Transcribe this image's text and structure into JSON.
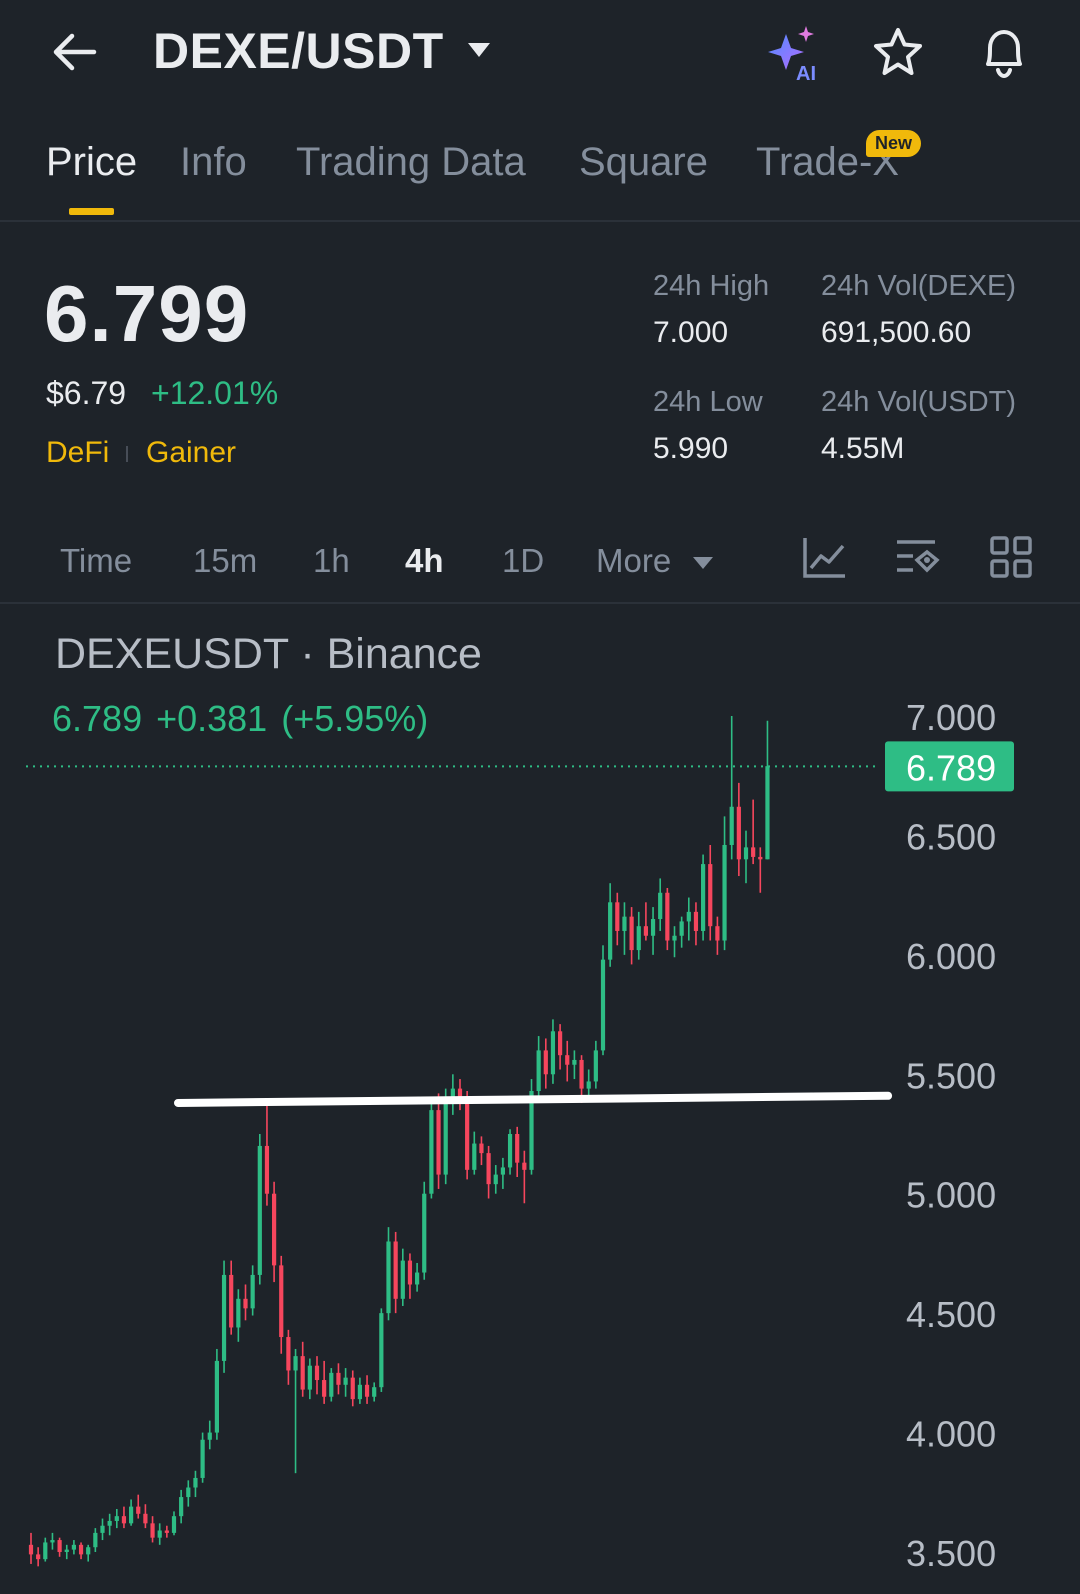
{
  "header": {
    "pair": "DEXE/USDT",
    "icons": [
      "back-arrow-icon",
      "chevron-down-icon",
      "ai-sparkle-icon",
      "star-icon",
      "bell-icon"
    ]
  },
  "tabs": [
    {
      "label": "Price",
      "active": true
    },
    {
      "label": "Info"
    },
    {
      "label": "Trading Data"
    },
    {
      "label": "Square"
    },
    {
      "label": "Trade-X",
      "badge": "New"
    }
  ],
  "ticker": {
    "last_price": "6.799",
    "usd_price": "$6.79",
    "change_pct": "+12.01%",
    "tags": [
      "DeFi",
      "Gainer"
    ],
    "stats": {
      "high_label": "24h High",
      "high_value": "7.000",
      "vol_base_label": "24h Vol(DEXE)",
      "vol_base_value": "691,500.60",
      "low_label": "24h Low",
      "low_value": "5.990",
      "vol_quote_label": "24h Vol(USDT)",
      "vol_quote_value": "4.55M"
    }
  },
  "intervals": {
    "items": [
      "Time",
      "15m",
      "1h",
      "4h",
      "1D",
      "More"
    ],
    "active": "4h",
    "tools": [
      "indicator-chart-icon",
      "chart-settings-icon",
      "grid-layout-icon"
    ]
  },
  "colors": {
    "up": "#2ebd85",
    "down": "#f6465d",
    "accent": "#f0b90b",
    "background": "#1e2329"
  },
  "chart_data": {
    "type": "candlestick",
    "title": "DEXEUSDT · Binance",
    "legend": {
      "close": "6.789",
      "change": "+0.381",
      "change_pct": "(+5.95%)"
    },
    "last_price_label": "6.789",
    "last_price": 6.789,
    "y_ticks": [
      "7.000",
      "6.500",
      "6.000",
      "5.500",
      "5.000",
      "4.500",
      "4.000",
      "3.500"
    ],
    "y_tick_values": [
      7.0,
      6.5,
      6.0,
      5.5,
      5.0,
      4.5,
      4.0,
      3.5
    ],
    "ylim": [
      3.42,
      7.15
    ],
    "trend_line": {
      "from": [
        0,
        5.38
      ],
      "to": [
        114,
        5.41
      ]
    },
    "candles": [
      [
        3.53,
        3.58,
        3.45,
        3.49
      ],
      [
        3.49,
        3.52,
        3.44,
        3.47
      ],
      [
        3.47,
        3.56,
        3.46,
        3.54
      ],
      [
        3.54,
        3.58,
        3.51,
        3.55
      ],
      [
        3.55,
        3.56,
        3.48,
        3.5
      ],
      [
        3.5,
        3.53,
        3.47,
        3.51
      ],
      [
        3.51,
        3.55,
        3.49,
        3.53
      ],
      [
        3.53,
        3.54,
        3.47,
        3.49
      ],
      [
        3.49,
        3.53,
        3.46,
        3.52
      ],
      [
        3.52,
        3.6,
        3.5,
        3.58
      ],
      [
        3.58,
        3.64,
        3.55,
        3.61
      ],
      [
        3.61,
        3.66,
        3.57,
        3.63
      ],
      [
        3.63,
        3.68,
        3.6,
        3.65
      ],
      [
        3.65,
        3.69,
        3.6,
        3.62
      ],
      [
        3.62,
        3.72,
        3.61,
        3.69
      ],
      [
        3.69,
        3.74,
        3.64,
        3.66
      ],
      [
        3.66,
        3.7,
        3.6,
        3.62
      ],
      [
        3.62,
        3.65,
        3.54,
        3.56
      ],
      [
        3.56,
        3.62,
        3.53,
        3.59
      ],
      [
        3.59,
        3.61,
        3.56,
        3.58
      ],
      [
        3.58,
        3.67,
        3.57,
        3.65
      ],
      [
        3.65,
        3.76,
        3.62,
        3.73
      ],
      [
        3.73,
        3.8,
        3.69,
        3.77
      ],
      [
        3.77,
        3.84,
        3.73,
        3.81
      ],
      [
        3.81,
        4.0,
        3.79,
        3.97
      ],
      [
        3.97,
        4.05,
        3.93,
        4.0
      ],
      [
        4.0,
        4.35,
        3.97,
        4.3
      ],
      [
        4.3,
        4.72,
        4.25,
        4.66
      ],
      [
        4.66,
        4.72,
        4.41,
        4.44
      ],
      [
        4.44,
        4.6,
        4.38,
        4.56
      ],
      [
        4.56,
        4.62,
        4.47,
        4.52
      ],
      [
        4.52,
        4.7,
        4.49,
        4.66
      ],
      [
        4.66,
        5.25,
        4.62,
        5.2
      ],
      [
        5.2,
        5.4,
        4.95,
        5.0
      ],
      [
        5.0,
        5.05,
        4.63,
        4.7
      ],
      [
        4.7,
        4.74,
        4.33,
        4.4
      ],
      [
        4.4,
        4.43,
        4.2,
        4.26
      ],
      [
        4.26,
        4.35,
        3.83,
        4.32
      ],
      [
        4.32,
        4.38,
        4.15,
        4.18
      ],
      [
        4.18,
        4.31,
        4.14,
        4.28
      ],
      [
        4.28,
        4.32,
        4.16,
        4.22
      ],
      [
        4.22,
        4.3,
        4.12,
        4.15
      ],
      [
        4.15,
        4.27,
        4.13,
        4.25
      ],
      [
        4.25,
        4.29,
        4.16,
        4.2
      ],
      [
        4.2,
        4.27,
        4.15,
        4.23
      ],
      [
        4.23,
        4.26,
        4.11,
        4.14
      ],
      [
        4.14,
        4.23,
        4.12,
        4.2
      ],
      [
        4.2,
        4.24,
        4.12,
        4.15
      ],
      [
        4.15,
        4.21,
        4.13,
        4.19
      ],
      [
        4.19,
        4.52,
        4.17,
        4.5
      ],
      [
        4.5,
        4.86,
        4.47,
        4.8
      ],
      [
        4.8,
        4.84,
        4.5,
        4.56
      ],
      [
        4.56,
        4.77,
        4.53,
        4.72
      ],
      [
        4.72,
        4.75,
        4.56,
        4.62
      ],
      [
        4.62,
        4.71,
        4.59,
        4.67
      ],
      [
        4.67,
        5.05,
        4.64,
        5.0
      ],
      [
        5.0,
        5.4,
        4.98,
        5.35
      ],
      [
        5.35,
        5.42,
        5.02,
        5.08
      ],
      [
        5.08,
        5.44,
        5.04,
        5.38
      ],
      [
        5.38,
        5.5,
        5.33,
        5.44
      ],
      [
        5.44,
        5.48,
        5.35,
        5.39
      ],
      [
        5.39,
        5.43,
        5.06,
        5.1
      ],
      [
        5.1,
        5.26,
        5.08,
        5.21
      ],
      [
        5.21,
        5.24,
        5.12,
        5.17
      ],
      [
        5.17,
        5.2,
        4.98,
        5.04
      ],
      [
        5.04,
        5.12,
        5.0,
        5.08
      ],
      [
        5.08,
        5.15,
        5.02,
        5.11
      ],
      [
        5.11,
        5.27,
        5.08,
        5.25
      ],
      [
        5.25,
        5.28,
        5.07,
        5.13
      ],
      [
        5.13,
        5.18,
        4.96,
        5.1
      ],
      [
        5.1,
        5.48,
        5.08,
        5.43
      ],
      [
        5.43,
        5.66,
        5.4,
        5.6
      ],
      [
        5.6,
        5.65,
        5.44,
        5.5
      ],
      [
        5.5,
        5.73,
        5.46,
        5.68
      ],
      [
        5.68,
        5.71,
        5.52,
        5.58
      ],
      [
        5.58,
        5.64,
        5.47,
        5.54
      ],
      [
        5.54,
        5.6,
        5.48,
        5.56
      ],
      [
        5.56,
        5.58,
        5.38,
        5.44
      ],
      [
        5.44,
        5.52,
        5.41,
        5.47
      ],
      [
        5.47,
        5.64,
        5.44,
        5.6
      ],
      [
        5.6,
        6.04,
        5.58,
        5.98
      ],
      [
        5.98,
        6.3,
        5.95,
        6.22
      ],
      [
        6.22,
        6.26,
        6.04,
        6.1
      ],
      [
        6.1,
        6.22,
        6.0,
        6.16
      ],
      [
        6.16,
        6.2,
        5.96,
        6.02
      ],
      [
        6.02,
        6.18,
        5.98,
        6.12
      ],
      [
        6.12,
        6.22,
        6.06,
        6.08
      ],
      [
        6.08,
        6.2,
        6.0,
        6.15
      ],
      [
        6.15,
        6.32,
        6.1,
        6.26
      ],
      [
        6.26,
        6.28,
        6.02,
        6.06
      ],
      [
        6.06,
        6.12,
        5.99,
        6.08
      ],
      [
        6.08,
        6.16,
        6.03,
        6.14
      ],
      [
        6.14,
        6.24,
        6.06,
        6.18
      ],
      [
        6.18,
        6.22,
        6.04,
        6.1
      ],
      [
        6.1,
        6.42,
        6.06,
        6.38
      ],
      [
        6.38,
        6.46,
        6.06,
        6.12
      ],
      [
        6.12,
        6.16,
        6.0,
        6.06
      ],
      [
        6.06,
        6.58,
        6.02,
        6.46
      ],
      [
        6.46,
        7.0,
        6.4,
        6.62
      ],
      [
        6.62,
        6.72,
        6.33,
        6.4
      ],
      [
        6.4,
        6.52,
        6.3,
        6.45
      ],
      [
        6.45,
        6.65,
        6.38,
        6.41
      ],
      [
        6.41,
        6.45,
        6.26,
        6.4
      ],
      [
        6.4,
        6.98,
        6.4,
        6.79
      ]
    ]
  }
}
